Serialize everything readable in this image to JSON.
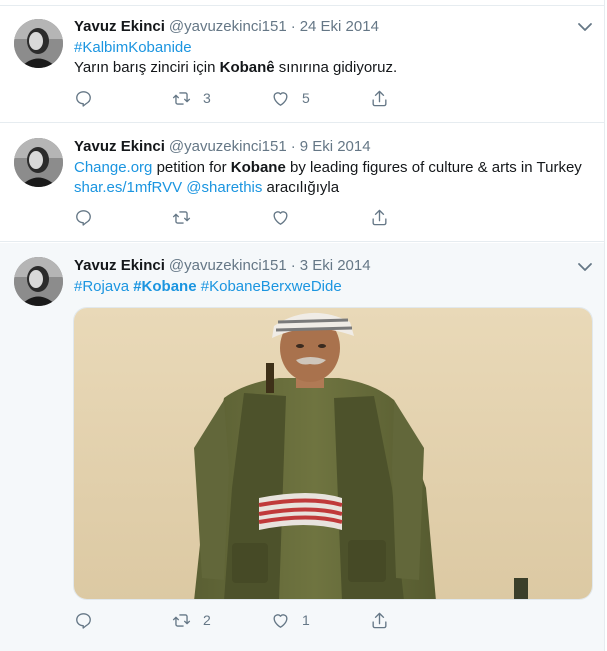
{
  "tweets": [
    {
      "name": "Yavuz Ekinci",
      "handle": "@yavuzekinci151",
      "separator": "·",
      "date": "24 Eki 2014",
      "line1": {
        "hashtag": "#KalbimKobanide"
      },
      "line2": {
        "before": "Yarın barış zinciri için ",
        "bold": "Kobanê",
        "after": " sınırına gidiyoruz."
      },
      "actions": {
        "retweets": "3",
        "likes": "5"
      }
    },
    {
      "name": "Yavuz Ekinci",
      "handle": "@yavuzekinci151",
      "separator": "·",
      "date": "9 Eki 2014",
      "line1": {
        "link": "Change.org",
        "before": " petition for ",
        "bold": "Kobane",
        "after": " by leading figures of culture & arts in Turkey"
      },
      "line2": {
        "link1": "shar.es/1mfRVV",
        "space": " ",
        "link2": "@sharethis",
        "after": " aracılığıyla"
      },
      "actions": {
        "retweets": "",
        "likes": ""
      }
    },
    {
      "name": "Yavuz Ekinci",
      "handle": "@yavuzekinci151",
      "separator": "·",
      "date": "3 Eki 2014",
      "line1": {
        "tag1": "#Rojava",
        "tag2": "#Kobane",
        "tag3": "#KobaneBerxweDide"
      },
      "actions": {
        "retweets": "2",
        "likes": "1"
      }
    }
  ],
  "icons": {
    "reply": "reply-icon",
    "retweet": "retweet-icon",
    "like": "heart-icon",
    "share": "share-icon",
    "caret": "chevron-down-icon"
  },
  "colors": {
    "link": "#1b95e0",
    "muted": "#657786",
    "border": "#e6ecf0",
    "hover_bg": "#f5f8fa"
  }
}
